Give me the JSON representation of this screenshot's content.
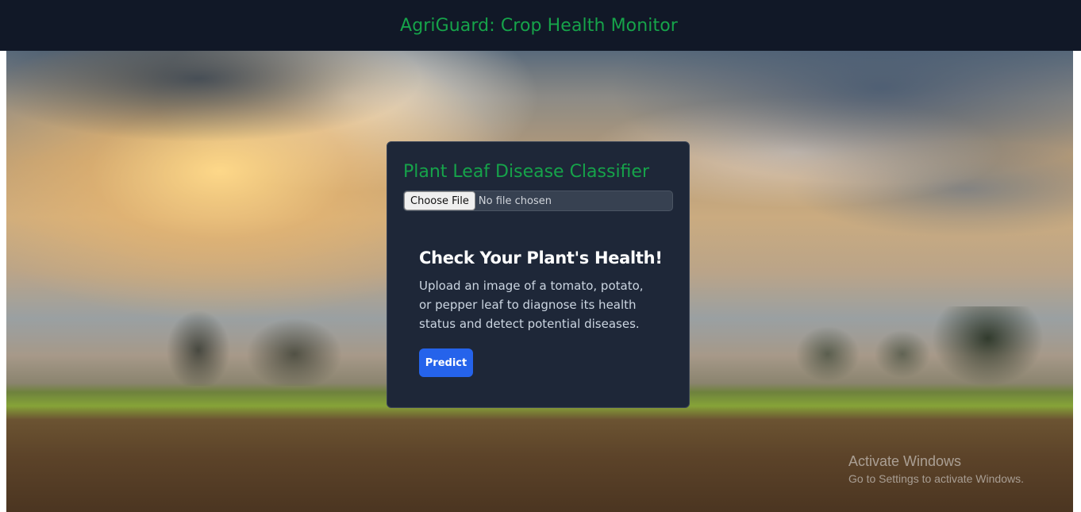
{
  "header": {
    "title": "AgriGuard: Crop Health Monitor"
  },
  "classifier": {
    "title": "Plant Leaf Disease Classifier",
    "file_input": {
      "button_label": "Choose File",
      "status": "No file chosen"
    },
    "info": {
      "heading": "Check Your Plant's Health!",
      "description": "Upload an image of a tomato, potato, or pepper leaf to diagnose its health status and detect potential diseases."
    },
    "predict_label": "Predict"
  },
  "watermark": {
    "title": "Activate Windows",
    "subtitle": "Go to Settings to activate Windows."
  },
  "colors": {
    "header_bg": "#111827",
    "accent_green": "#16a34a",
    "card_bg": "#1e2738",
    "button_blue": "#2563eb"
  }
}
